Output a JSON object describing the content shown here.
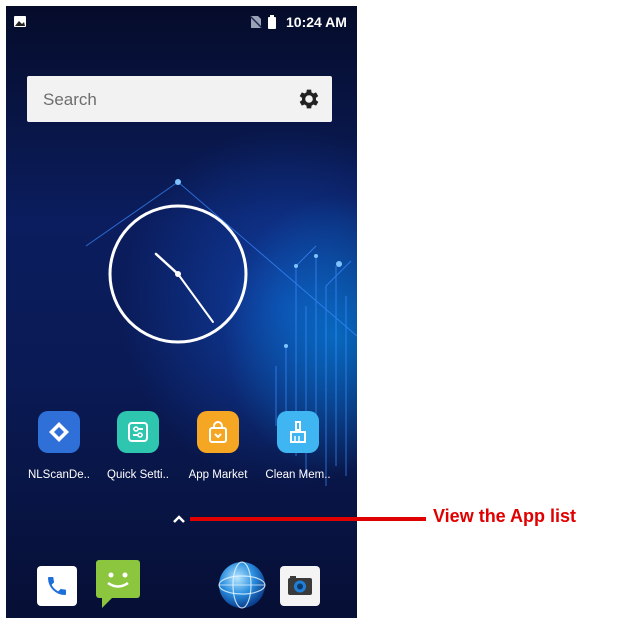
{
  "status_bar": {
    "time": "10:24 AM",
    "icons": [
      "image-notification-icon",
      "no-sim-icon",
      "battery-icon"
    ]
  },
  "search": {
    "placeholder": "Search",
    "settings_icon": "gear-icon"
  },
  "clock_widget": {
    "type": "analog-clock"
  },
  "apps": [
    {
      "label": "NLScanDe..",
      "icon": "nlscan-demo-icon",
      "color": "#2f6fd8"
    },
    {
      "label": "Quick Setti..",
      "icon": "quick-settings-icon",
      "color": "#2fc6b0"
    },
    {
      "label": "App Market",
      "icon": "app-market-bag-icon",
      "color": "#f5a623"
    },
    {
      "label": "Clean Mem..",
      "icon": "clean-memory-broom-icon",
      "color": "#3fb6f2"
    }
  ],
  "app_drawer_arrow": "chevron-up-icon",
  "dock": [
    {
      "name": "phone",
      "icon": "phone-icon"
    },
    {
      "name": "messages",
      "icon": "messages-icon"
    },
    {
      "name": "browser",
      "icon": "globe-icon"
    },
    {
      "name": "camera",
      "icon": "camera-icon"
    }
  ],
  "annotation": {
    "text": "View the App list",
    "color": "#e00000"
  }
}
